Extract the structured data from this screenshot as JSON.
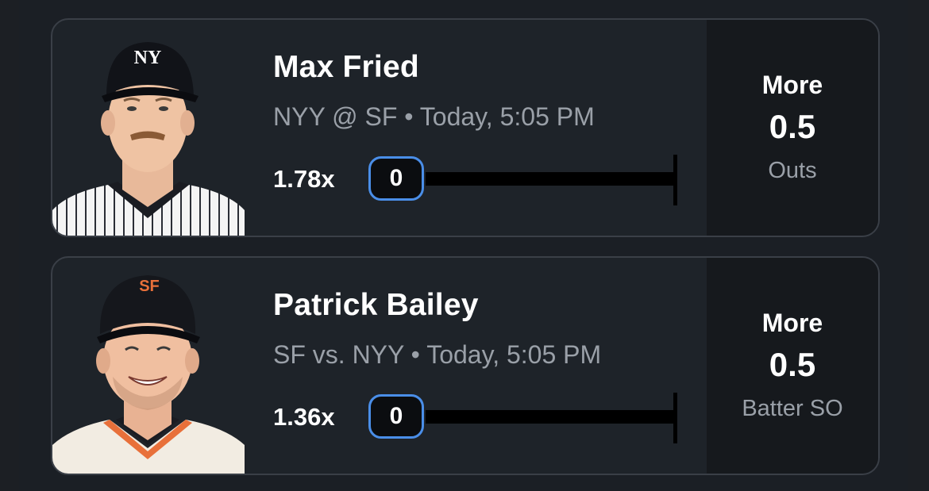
{
  "picks": [
    {
      "player_name": "Max Fried",
      "matchup": "NYY @ SF • Today, 5:05 PM",
      "multiplier": "1.78x",
      "progress_value": "0",
      "direction": "More",
      "line": "0.5",
      "stat": "Outs",
      "cap_logo": "NY"
    },
    {
      "player_name": "Patrick Bailey",
      "matchup": "SF vs. NYY • Today, 5:05 PM",
      "multiplier": "1.36x",
      "progress_value": "0",
      "direction": "More",
      "line": "0.5",
      "stat": "Batter SO",
      "cap_logo": "SF"
    }
  ],
  "colors": {
    "background": "#1c1f24",
    "card": "#1e2329",
    "card_border": "#3a3f47",
    "pick_panel": "#16191d",
    "accent_blue": "#4a8ee8",
    "muted_text": "#9aa0a8",
    "sf_orange": "#e8703a"
  }
}
